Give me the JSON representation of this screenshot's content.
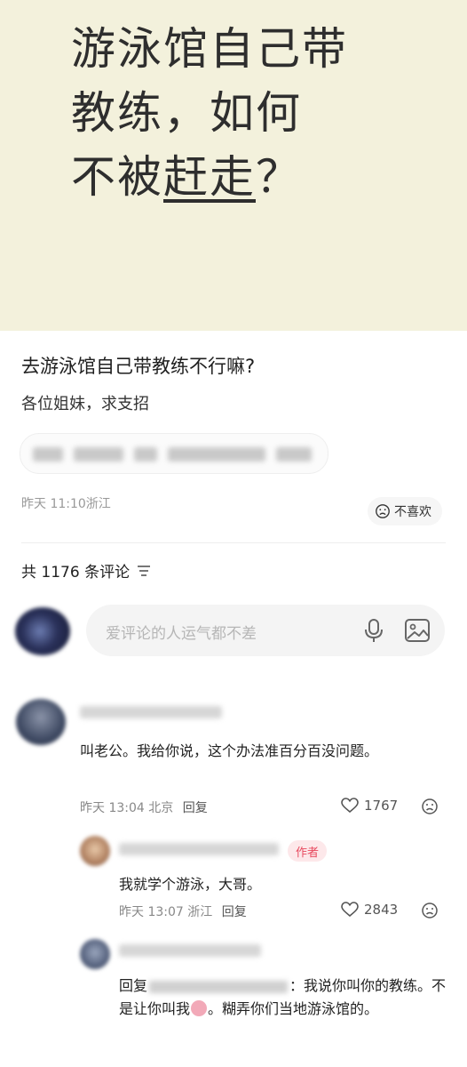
{
  "cover": {
    "line1": "游泳馆自己带",
    "line2": "教练，如何",
    "line3_prefix": "不被",
    "line3_underlined": "赶走",
    "line3_suffix": "？",
    "background_color": "#f3f1dc"
  },
  "post": {
    "title": "去游泳馆自己带教练不行嘛?",
    "body": "各位姐妹，求支招",
    "meta": "昨天 11:10浙江",
    "dislike_label": "不喜欢"
  },
  "comments_header": {
    "count_label": "共 1176 条评论"
  },
  "comment_input": {
    "placeholder": "爱评论的人运气都不差"
  },
  "comments": [
    {
      "text": "叫老公。我给你说，这个办法准百分百没问题。",
      "time": "昨天 13:04",
      "location": "北京",
      "reply_label": "回复",
      "likes": "1767"
    },
    {
      "badge": "作者",
      "text": "我就学个游泳，大哥。",
      "time": "昨天 13:07",
      "location": "浙江",
      "reply_label": "回复",
      "likes": "2843"
    },
    {
      "text_prefix": "回复",
      "text_middle": "：我说你叫你的教练。不是让你叫我",
      "text_suffix": "。糊弄你们当地游泳馆的。"
    }
  ],
  "colors": {
    "accent_badge": "#e84a5f",
    "muted_text": "#999999"
  }
}
